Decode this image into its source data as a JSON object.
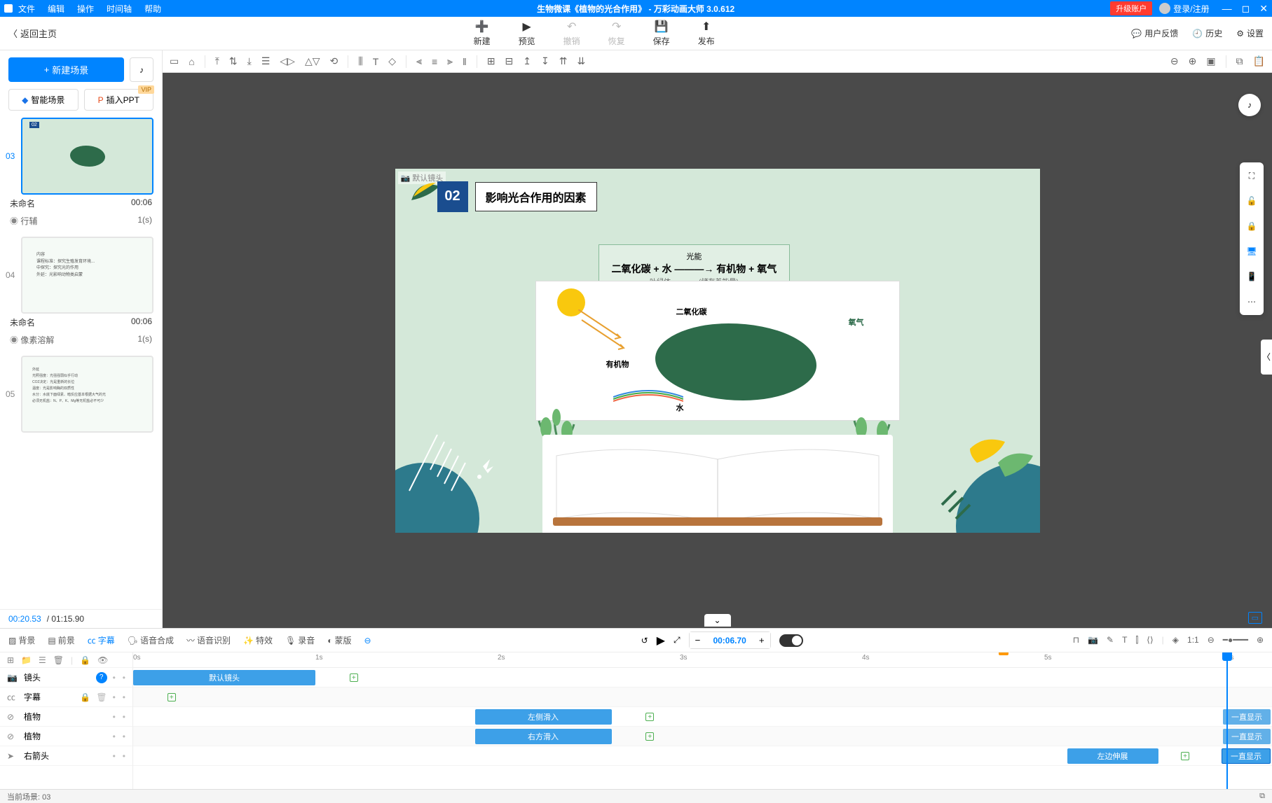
{
  "titlebar": {
    "menus": [
      "文件",
      "编辑",
      "操作",
      "时间轴",
      "帮助"
    ],
    "title": "生物微课《植物的光合作用》 - 万彩动画大师 3.0.612",
    "upgrade": "升级账户",
    "login": "登录/注册"
  },
  "toptoolbar": {
    "back": "返回主页",
    "buttons": {
      "new": "新建",
      "preview": "预览",
      "undo": "撤销",
      "redo": "恢复",
      "save": "保存",
      "publish": "发布"
    },
    "links": {
      "feedback": "用户反馈",
      "history": "历史",
      "settings": "设置"
    }
  },
  "leftpanel": {
    "newscene": "新建场景",
    "aiscene": "智能场景",
    "insertppt": "插入PPT",
    "vip": "VIP",
    "scenes": [
      {
        "num": "03",
        "name": "未命名",
        "duration": "00:06",
        "transition": "行辅",
        "trans_time": "1(s)",
        "active": true
      },
      {
        "num": "04",
        "name": "未命名",
        "duration": "00:06",
        "transition": "像素溶解",
        "trans_time": "1(s)",
        "active": false
      },
      {
        "num": "05",
        "name": "",
        "duration": "",
        "transition": "",
        "trans_time": "",
        "active": false
      }
    ],
    "time_current": "00:20.53",
    "time_total": "/ 01:15.90"
  },
  "canvas": {
    "default_camera": "默认镜头",
    "title_num": "02",
    "title_text": "影响光合作用的因素",
    "formula_top": "光能",
    "formula_main": "二氧化碳 + 水 ———→ 有机物 + 氧气",
    "formula_mid": "叶绿体",
    "formula_sub": "(储存着能量)",
    "labels": {
      "co2": "二氧化碳",
      "o2": "氧气",
      "organic": "有机物",
      "water": "水"
    }
  },
  "timeline": {
    "tabs": {
      "background": "背景",
      "foreground": "前景",
      "subtitle": "字幕",
      "tts": "语音合成",
      "asr": "语音识别",
      "fx": "特效",
      "record": "录音",
      "mask": "蒙版"
    },
    "time_value": "00:06.70",
    "ruler": [
      "0s",
      "1s",
      "2s",
      "3s",
      "4s",
      "5s",
      "6s"
    ],
    "tracks": {
      "camera": "镜头",
      "subtitle": "字幕",
      "plant1": "植物",
      "plant2": "植物",
      "arrow": "右箭头"
    },
    "clips": {
      "default_camera": "默认镜头",
      "slide_left": "左侧滑入",
      "slide_right": "右方滑入",
      "stretch_left": "左边伸展",
      "always_show": "一直显示"
    }
  },
  "statusbar": {
    "current": "当前场景: 03"
  }
}
